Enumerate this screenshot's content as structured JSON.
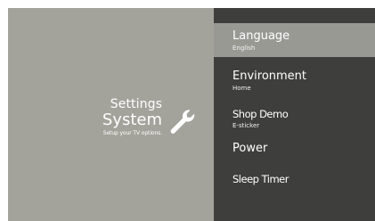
{
  "panel": {
    "title": "Settings",
    "subtitle": "System",
    "description": "Setup your TV options."
  },
  "icons": {
    "system": "wrench-icon"
  },
  "colors": {
    "left_panel_bg": "#a3a39c",
    "right_panel_bg": "#3e3e3c",
    "selected_bg": "#999994",
    "text": "#ffffff"
  },
  "menu": {
    "selected_index": 0,
    "items": [
      {
        "label": "Language",
        "value": "English"
      },
      {
        "label": "Environment",
        "value": "Home"
      },
      {
        "label": "Shop Demo",
        "value": "E-sticker"
      },
      {
        "label": "Power"
      },
      {
        "label": "Sleep Timer"
      }
    ]
  }
}
